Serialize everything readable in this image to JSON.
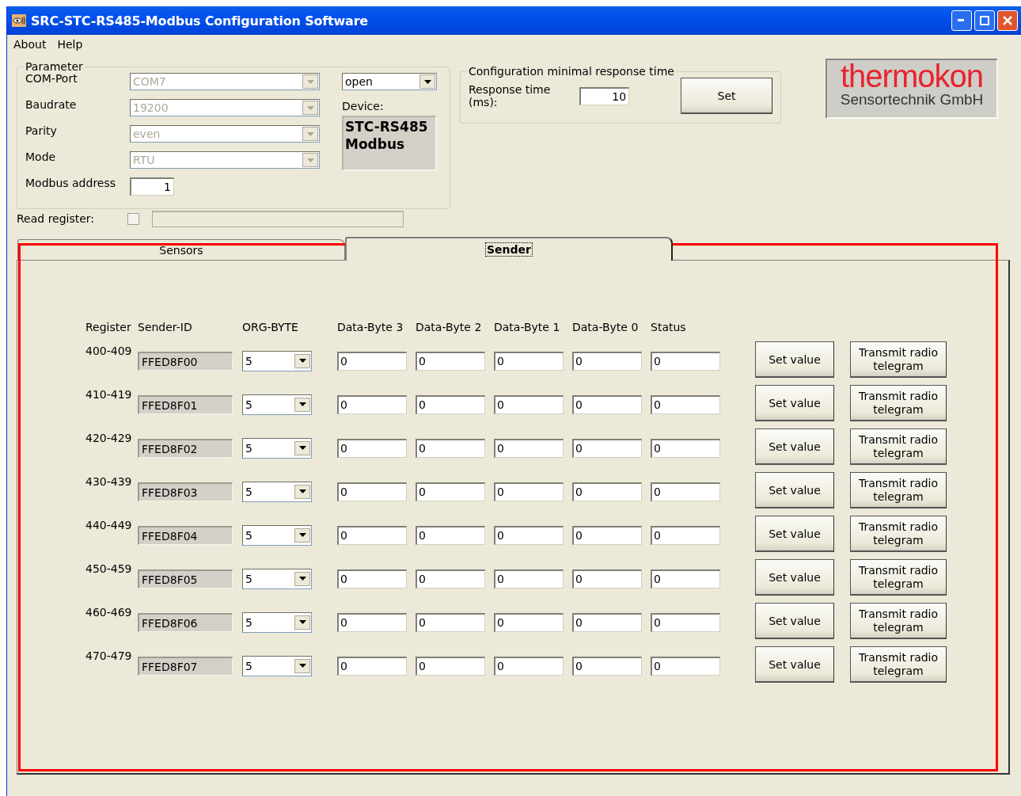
{
  "window": {
    "title": "SRC-STC-RS485-Modbus Configuration Software"
  },
  "menu": [
    {
      "label": "About"
    },
    {
      "label": "Help"
    }
  ],
  "parameter": {
    "title": "Parameter",
    "fields": [
      {
        "label": "COM-Port",
        "value": "COM7",
        "disabled": true
      },
      {
        "label": "Baudrate",
        "value": "19200",
        "disabled": true
      },
      {
        "label": "Parity",
        "value": "even",
        "disabled": true
      },
      {
        "label": "Mode",
        "value": "RTU",
        "disabled": true
      }
    ],
    "modbus_address": {
      "label": "Modbus address",
      "value": "1"
    },
    "port_state": {
      "value": "open"
    },
    "device": {
      "label": "Device:",
      "value": "STC-RS485 Modbus"
    }
  },
  "response": {
    "title": "Configuration minimal response time",
    "label": "Response time (ms):",
    "value": "10",
    "button": "Set"
  },
  "logo": {
    "name": "thermokon",
    "subtitle": "Sensortechnik GmbH"
  },
  "read_register": {
    "label": "Read register:",
    "checked": false
  },
  "tabs": [
    {
      "label": "Sensors",
      "selected": false
    },
    {
      "label": "Sender",
      "selected": true
    }
  ],
  "sender_table": {
    "columns": [
      "Register",
      "Sender-ID",
      "ORG-BYTE",
      "Data-Byte 3",
      "Data-Byte 2",
      "Data-Byte 1",
      "Data-Byte 0",
      "Status"
    ],
    "rows": [
      {
        "register": "400-409",
        "sender_id": "FFED8F00",
        "org_byte": "5",
        "data": [
          "0",
          "0",
          "0",
          "0"
        ],
        "status": "0",
        "set_button": "Set value",
        "transmit_button": "Transmit radio telegram"
      },
      {
        "register": "410-419",
        "sender_id": "FFED8F01",
        "org_byte": "5",
        "data": [
          "0",
          "0",
          "0",
          "0"
        ],
        "status": "0",
        "set_button": "Set value",
        "transmit_button": "Transmit radio telegram"
      },
      {
        "register": "420-429",
        "sender_id": "FFED8F02",
        "org_byte": "5",
        "data": [
          "0",
          "0",
          "0",
          "0"
        ],
        "status": "0",
        "set_button": "Set value",
        "transmit_button": "Transmit radio telegram"
      },
      {
        "register": "430-439",
        "sender_id": "FFED8F03",
        "org_byte": "5",
        "data": [
          "0",
          "0",
          "0",
          "0"
        ],
        "status": "0",
        "set_button": "Set value",
        "transmit_button": "Transmit radio telegram"
      },
      {
        "register": "440-449",
        "sender_id": "FFED8F04",
        "org_byte": "5",
        "data": [
          "0",
          "0",
          "0",
          "0"
        ],
        "status": "0",
        "set_button": "Set value",
        "transmit_button": "Transmit radio telegram"
      },
      {
        "register": "450-459",
        "sender_id": "FFED8F05",
        "org_byte": "5",
        "data": [
          "0",
          "0",
          "0",
          "0"
        ],
        "status": "0",
        "set_button": "Set value",
        "transmit_button": "Transmit radio telegram"
      },
      {
        "register": "460-469",
        "sender_id": "FFED8F06",
        "org_byte": "5",
        "data": [
          "0",
          "0",
          "0",
          "0"
        ],
        "status": "0",
        "set_button": "Set value",
        "transmit_button": "Transmit radio telegram"
      },
      {
        "register": "470-479",
        "sender_id": "FFED8F07",
        "org_byte": "5",
        "data": [
          "0",
          "0",
          "0",
          "0"
        ],
        "status": "0",
        "set_button": "Set value",
        "transmit_button": "Transmit radio telegram"
      }
    ]
  }
}
